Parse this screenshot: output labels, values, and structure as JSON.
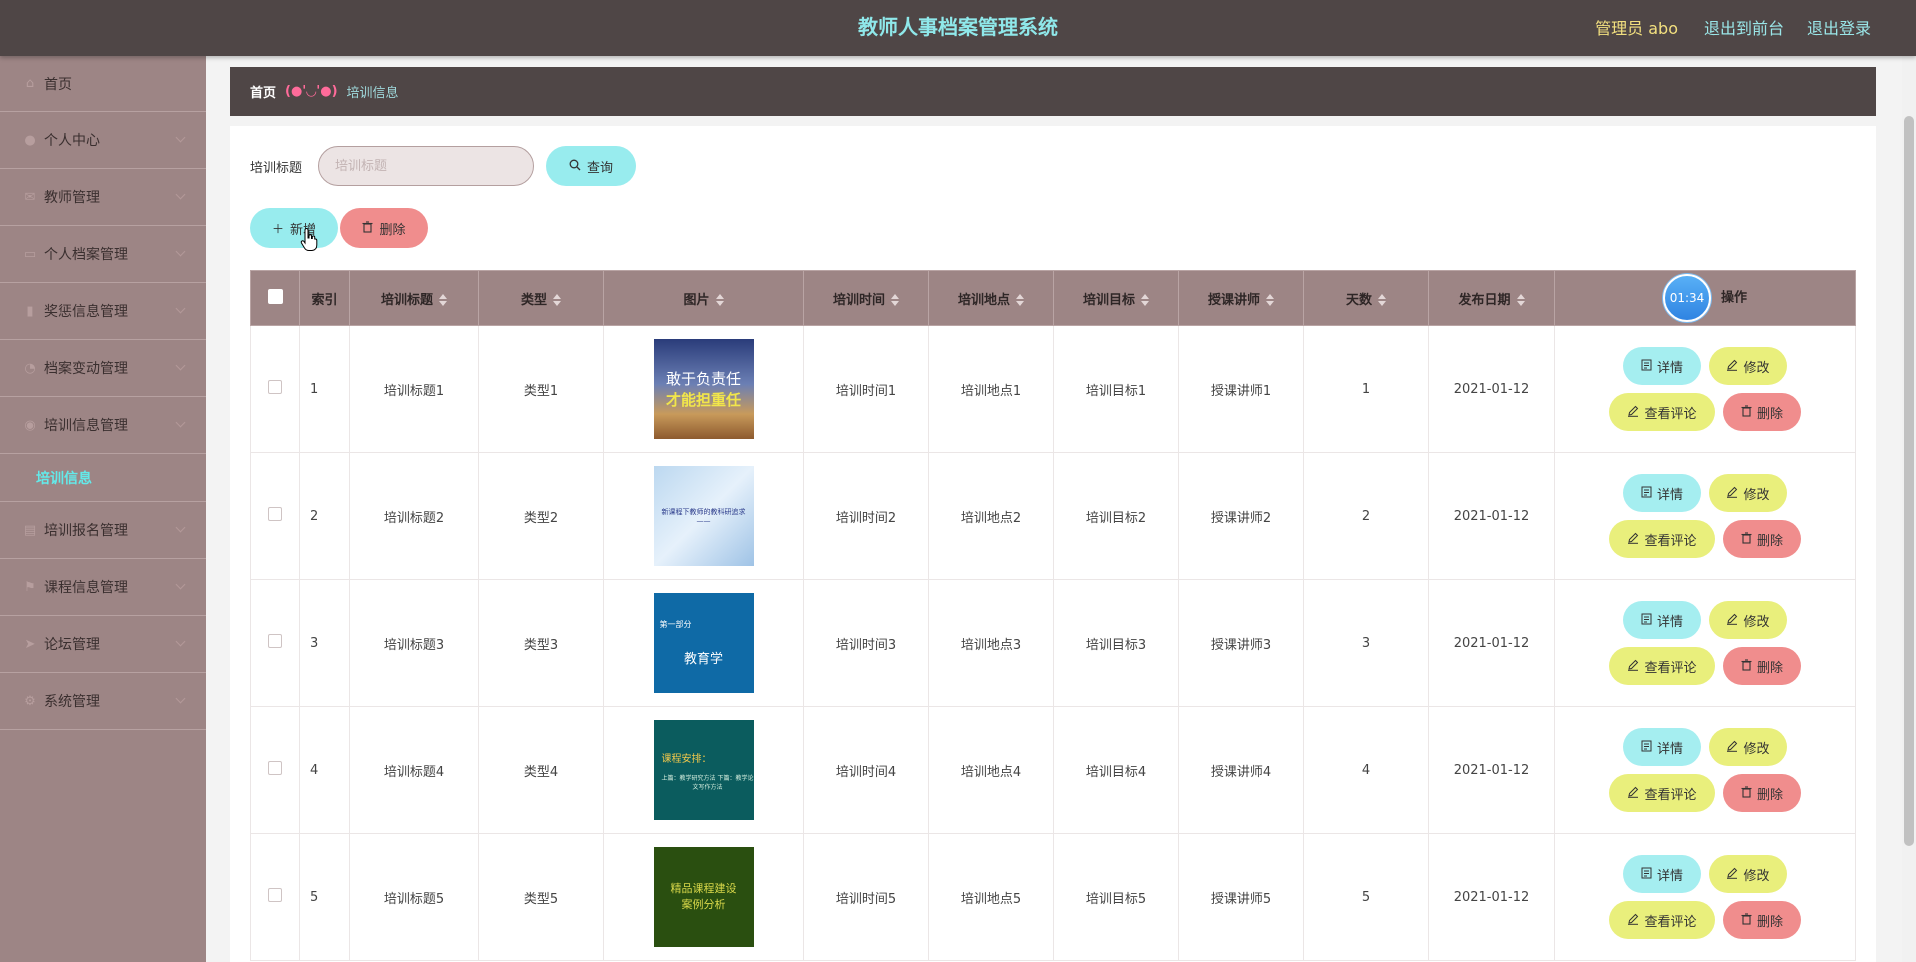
{
  "header": {
    "title": "教师人事档案管理系统",
    "user": "管理员 abo",
    "to_front": "退出到前台",
    "logout": "退出登录"
  },
  "sidebar": {
    "items": [
      {
        "label": "首页",
        "icon": "home-icon",
        "glyph": "⌂",
        "arrow": false
      },
      {
        "label": "个人中心",
        "icon": "user-icon",
        "glyph": "●",
        "arrow": true
      },
      {
        "label": "教师管理",
        "icon": "mail-icon",
        "glyph": "✉",
        "arrow": true
      },
      {
        "label": "个人档案管理",
        "icon": "chat-icon",
        "glyph": "▭",
        "arrow": true
      },
      {
        "label": "奖惩信息管理",
        "icon": "trash-icon",
        "glyph": "▮",
        "arrow": true
      },
      {
        "label": "档案变动管理",
        "icon": "compass-icon",
        "glyph": "◔",
        "arrow": true
      },
      {
        "label": "培训信息管理",
        "icon": "location-icon",
        "glyph": "◉",
        "arrow": true
      }
    ],
    "submenu": "培训信息",
    "items2": [
      {
        "label": "培训报名管理",
        "icon": "shopping-bag-icon",
        "glyph": "▤",
        "arrow": true
      },
      {
        "label": "课程信息管理",
        "icon": "flag-icon",
        "glyph": "⚑",
        "arrow": true
      },
      {
        "label": "论坛管理",
        "icon": "send-icon",
        "glyph": "➤",
        "arrow": true
      },
      {
        "label": "系统管理",
        "icon": "settings-icon",
        "glyph": "⚙",
        "arrow": true
      }
    ]
  },
  "breadcrumb": {
    "home": "首页",
    "separator": "(●'◡'●)",
    "current": "培训信息"
  },
  "search": {
    "label": "培训标题",
    "placeholder": "培训标题",
    "query_button": "查询"
  },
  "actions": {
    "add": "新增",
    "delete": "删除"
  },
  "table": {
    "headers": [
      "索引",
      "培训标题",
      "类型",
      "图片",
      "培训时间",
      "培训地点",
      "培训目标",
      "授课讲师",
      "天数",
      "发布日期",
      "操作"
    ],
    "timer": "01:34",
    "row_buttons": {
      "detail": "详情",
      "edit": "修改",
      "comment": "查看评论",
      "delete": "删除"
    },
    "rows": [
      {
        "index": "1",
        "title": "培训标题1",
        "type": "类型1",
        "image": {
          "style": "t1",
          "lines": [
            "敢于负责任",
            "才能担重任"
          ]
        },
        "time": "培训时间1",
        "place": "培训地点1",
        "goal": "培训目标1",
        "teacher": "授课讲师1",
        "days": "1",
        "date": "2021-01-12"
      },
      {
        "index": "2",
        "title": "培训标题2",
        "type": "类型2",
        "image": {
          "style": "t2",
          "lines": [
            "新课程下教师的教科研追求",
            "——"
          ]
        },
        "time": "培训时间2",
        "place": "培训地点2",
        "goal": "培训目标2",
        "teacher": "授课讲师2",
        "days": "2",
        "date": "2021-01-12"
      },
      {
        "index": "3",
        "title": "培训标题3",
        "type": "类型3",
        "image": {
          "style": "t3",
          "lines": [
            "第一部分",
            "教育学"
          ]
        },
        "time": "培训时间3",
        "place": "培训地点3",
        "goal": "培训目标3",
        "teacher": "授课讲师3",
        "days": "3",
        "date": "2021-01-12"
      },
      {
        "index": "4",
        "title": "培训标题4",
        "type": "类型4",
        "image": {
          "style": "t4",
          "lines": [
            "课程安排：",
            "上篇：教学研究方法  下篇：教学论文写作方法"
          ]
        },
        "time": "培训时间4",
        "place": "培训地点4",
        "goal": "培训目标4",
        "teacher": "授课讲师4",
        "days": "4",
        "date": "2021-01-12"
      },
      {
        "index": "5",
        "title": "培训标题5",
        "type": "类型5",
        "image": {
          "style": "t5",
          "lines": [
            "精品课程建设",
            "案例分析"
          ]
        },
        "time": "培训时间5",
        "place": "培训地点5",
        "goal": "培训目标5",
        "teacher": "授课讲师5",
        "days": "5",
        "date": "2021-01-12"
      }
    ]
  }
}
